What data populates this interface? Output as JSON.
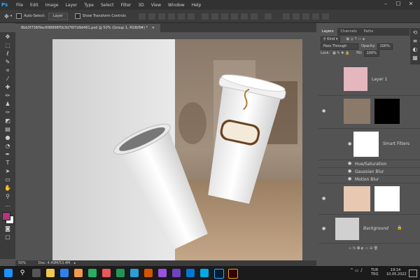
{
  "menu": {
    "logo": "Ps",
    "items": [
      "File",
      "Edit",
      "Image",
      "Layer",
      "Type",
      "Select",
      "Filter",
      "3D",
      "View",
      "Window",
      "Help"
    ]
  },
  "options": {
    "auto_select": "Auto-Select:",
    "layer_dropdown": "Layer",
    "show_transform": "Show Transform Controls"
  },
  "document": {
    "tab_label": "8bb3f736f9ec698898f5b3d76f7d9d461.psd @ 50% (Group 1, RGB/8#) *",
    "zoom": "50%",
    "doc_info": "Doc: 4.49M/53.4M"
  },
  "layers_panel": {
    "tabs": [
      "Layers",
      "Channels",
      "Paths"
    ],
    "kind": "Kind",
    "blend": "Pass Through",
    "opacity_label": "Opacity:",
    "opacity": "100%",
    "fill_label": "Fill:",
    "fill": "100%",
    "lock_label": "Lock:",
    "layer1_name": "Layer 1",
    "smart_filters": "Smart Filters",
    "filters": [
      "Hue/Saturation",
      "Gaussian Blur",
      "Motion Blur"
    ],
    "background": "Background"
  },
  "taskbar": {
    "lang": "TUR\nTRQ",
    "time": "19:14",
    "date": "10.05.2022"
  },
  "colors": {
    "foreground": "#b2387a",
    "background": "#ffffff"
  }
}
